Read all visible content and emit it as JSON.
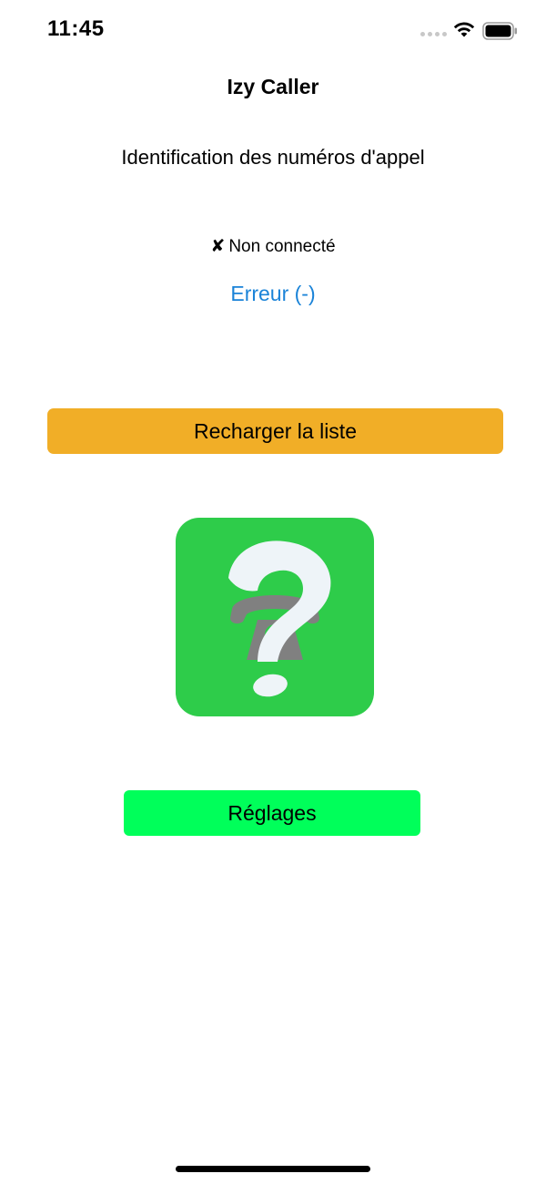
{
  "status_bar": {
    "time": "11:45",
    "icons": [
      "signal-dots-icon",
      "wifi-icon",
      "battery-icon"
    ]
  },
  "app": {
    "title": "Izy Caller",
    "subtitle": "Identification des numéros d'appel"
  },
  "connection": {
    "mark": "✘",
    "status": "Non connecté"
  },
  "error": {
    "label": "Erreur (-)"
  },
  "buttons": {
    "reload_label": "Recharger la liste",
    "settings_label": "Réglages"
  },
  "logo": {
    "icon": "phone-question-mark-logo"
  },
  "colors": {
    "reload_button": "#f1ae27",
    "settings_button": "#00ff5a",
    "link": "#1a83d8",
    "logo_background": "#2ecc4a",
    "logo_phone": "#808080",
    "logo_question_mark": "#eef4f8"
  }
}
